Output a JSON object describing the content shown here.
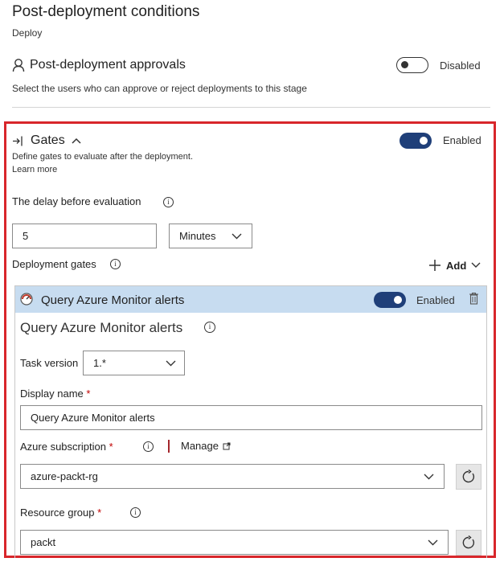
{
  "page": {
    "title": "Post-deployment conditions",
    "subtitle": "Deploy"
  },
  "approvals": {
    "label": "Post-deployment approvals",
    "toggle_state": "Disabled",
    "description": "Select the users who can approve or reject deployments to this stage"
  },
  "gates": {
    "label": "Gates",
    "toggle_state": "Enabled",
    "description": "Define gates to evaluate after the deployment.",
    "learn_more": "Learn more",
    "delay_label": "The delay before evaluation",
    "delay_value": "5",
    "delay_unit": "Minutes",
    "deployment_gates_label": "Deployment gates",
    "add_label": "Add"
  },
  "gate_item": {
    "header_title": "Query Azure Monitor alerts",
    "toggle_state": "Enabled",
    "title": "Query Azure Monitor alerts",
    "task_version_label": "Task version",
    "task_version_value": "1.*",
    "display_name_label": "Display name",
    "display_name_value": "Query Azure Monitor alerts",
    "subscription_label": "Azure subscription",
    "manage_label": "Manage",
    "subscription_value": "azure-packt-rg",
    "resource_group_label": "Resource group",
    "resource_group_value": "packt",
    "required_marker": "*"
  },
  "colors": {
    "accent": "#1f3f79",
    "highlight_border": "#d8262b",
    "gate_header_bg": "#c7dcf0",
    "required": "#c00000"
  },
  "icons": [
    "person-icon",
    "gate-arrow-icon",
    "chevron-up-icon",
    "info-icon",
    "chevron-down-icon",
    "plus-icon",
    "alert-gauge-icon",
    "trash-icon",
    "external-link-icon",
    "refresh-icon"
  ]
}
